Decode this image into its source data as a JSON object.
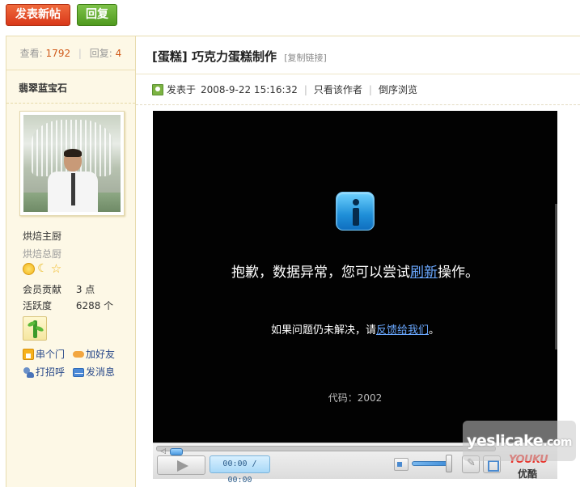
{
  "toolbar": {
    "new_post_label": "发表新帖",
    "reply_label": "回复"
  },
  "sidebar": {
    "views_label": "查看:",
    "views_value": "1792",
    "replies_label": "回复:",
    "replies_value": "4",
    "username": "翡翠蓝宝石",
    "rank": "烘焙主厨",
    "group": "烘焙总厨",
    "medals": [
      "sun-icon",
      "moon-icon",
      "star-icon"
    ],
    "contribution_label": "会员贡献",
    "contribution_value": "3 点",
    "activity_label": "活跃度",
    "activity_value": "6288 个",
    "actions": {
      "visit": "串个门",
      "add_friend": "加好友",
      "greet": "打招呼",
      "message": "发消息"
    }
  },
  "post": {
    "category": "[蛋糕]",
    "title": "巧克力蛋糕制作",
    "copy_link": "[复制链接]",
    "posted_label": "发表于",
    "posted_time": "2008-9-22 15:16:32",
    "author_only": "只看该作者",
    "reverse_view": "倒序浏览"
  },
  "player": {
    "error_prefix": "抱歉，数据异常，您可以尝试",
    "error_link": "刷新",
    "error_suffix": "操作。",
    "sub_prefix": "如果问题仍未解决，请",
    "sub_link": "反馈给我们",
    "sub_suffix": "。",
    "code": "代码：2002",
    "time": "00:00 / 00:00",
    "volume": 1.0,
    "brand_logo": "YOUKU",
    "brand_text": "优酷"
  },
  "watermark": {
    "text_main": "yeslicake",
    "text_suffix": ".com"
  },
  "colors": {
    "post_button": "#d9381a",
    "reply_button": "#4f9a1f",
    "stat_number": "#d05a1a",
    "link_blue": "#6aa8ff",
    "sidebar_bg": "#fdf8e6"
  }
}
